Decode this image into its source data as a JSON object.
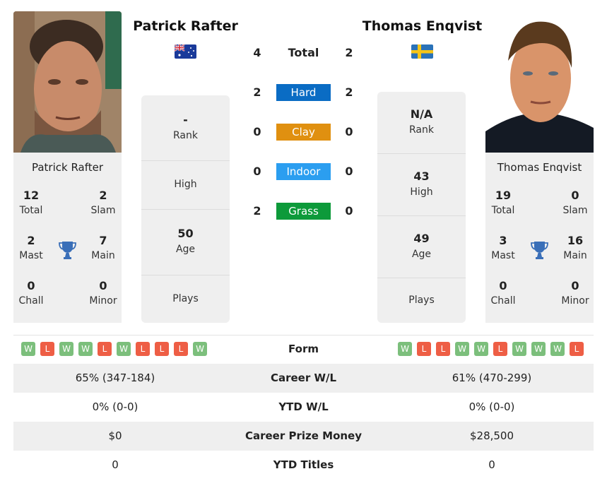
{
  "players": {
    "left": {
      "name": "Patrick Rafter",
      "card_name": "Patrick Rafter",
      "flag": "australia-flag",
      "titles": {
        "total": {
          "value": "12",
          "label": "Total"
        },
        "slam": {
          "value": "2",
          "label": "Slam"
        },
        "mast": {
          "value": "2",
          "label": "Mast"
        },
        "main": {
          "value": "7",
          "label": "Main"
        },
        "chall": {
          "value": "0",
          "label": "Chall"
        },
        "minor": {
          "value": "0",
          "label": "Minor"
        }
      },
      "info": {
        "rank": {
          "value": "-",
          "label": "Rank"
        },
        "high": {
          "value": "",
          "label": "High"
        },
        "age": {
          "value": "50",
          "label": "Age"
        },
        "plays": {
          "value": "",
          "label": "Plays"
        }
      },
      "form": [
        "W",
        "L",
        "W",
        "W",
        "L",
        "W",
        "L",
        "L",
        "L",
        "W"
      ]
    },
    "right": {
      "name": "Thomas Enqvist",
      "card_name": "Thomas Enqvist",
      "flag": "sweden-flag",
      "titles": {
        "total": {
          "value": "19",
          "label": "Total"
        },
        "slam": {
          "value": "0",
          "label": "Slam"
        },
        "mast": {
          "value": "3",
          "label": "Mast"
        },
        "main": {
          "value": "16",
          "label": "Main"
        },
        "chall": {
          "value": "0",
          "label": "Chall"
        },
        "minor": {
          "value": "0",
          "label": "Minor"
        }
      },
      "info": {
        "rank": {
          "value": "N/A",
          "label": "Rank"
        },
        "high": {
          "value": "43",
          "label": "High"
        },
        "age": {
          "value": "49",
          "label": "Age"
        },
        "plays": {
          "value": "",
          "label": "Plays"
        }
      },
      "form": [
        "W",
        "L",
        "L",
        "W",
        "W",
        "L",
        "W",
        "W",
        "W",
        "L"
      ]
    }
  },
  "h2h": {
    "total": {
      "label": "Total",
      "left": "4",
      "right": "2"
    },
    "surfaces": [
      {
        "label": "Hard",
        "left": "2",
        "right": "2",
        "color": "#0a6cc4"
      },
      {
        "label": "Clay",
        "left": "0",
        "right": "0",
        "color": "#e09010"
      },
      {
        "label": "Indoor",
        "left": "0",
        "right": "0",
        "color": "#2b9ef0"
      },
      {
        "label": "Grass",
        "left": "2",
        "right": "0",
        "color": "#0d9a3a"
      }
    ]
  },
  "comparison": {
    "form_label": "Form",
    "rows": [
      {
        "label": "Career W/L",
        "left": "65% (347-184)",
        "right": "61% (470-299)"
      },
      {
        "label": "YTD W/L",
        "left": "0% (0-0)",
        "right": "0% (0-0)"
      },
      {
        "label": "Career Prize Money",
        "left": "$0",
        "right": "$28,500"
      },
      {
        "label": "YTD Titles",
        "left": "0",
        "right": "0"
      }
    ]
  },
  "colors": {
    "win": "#7cbf7c",
    "loss": "#ee5e45",
    "trophy": "#3a6fb8",
    "panel": "#efefef"
  }
}
